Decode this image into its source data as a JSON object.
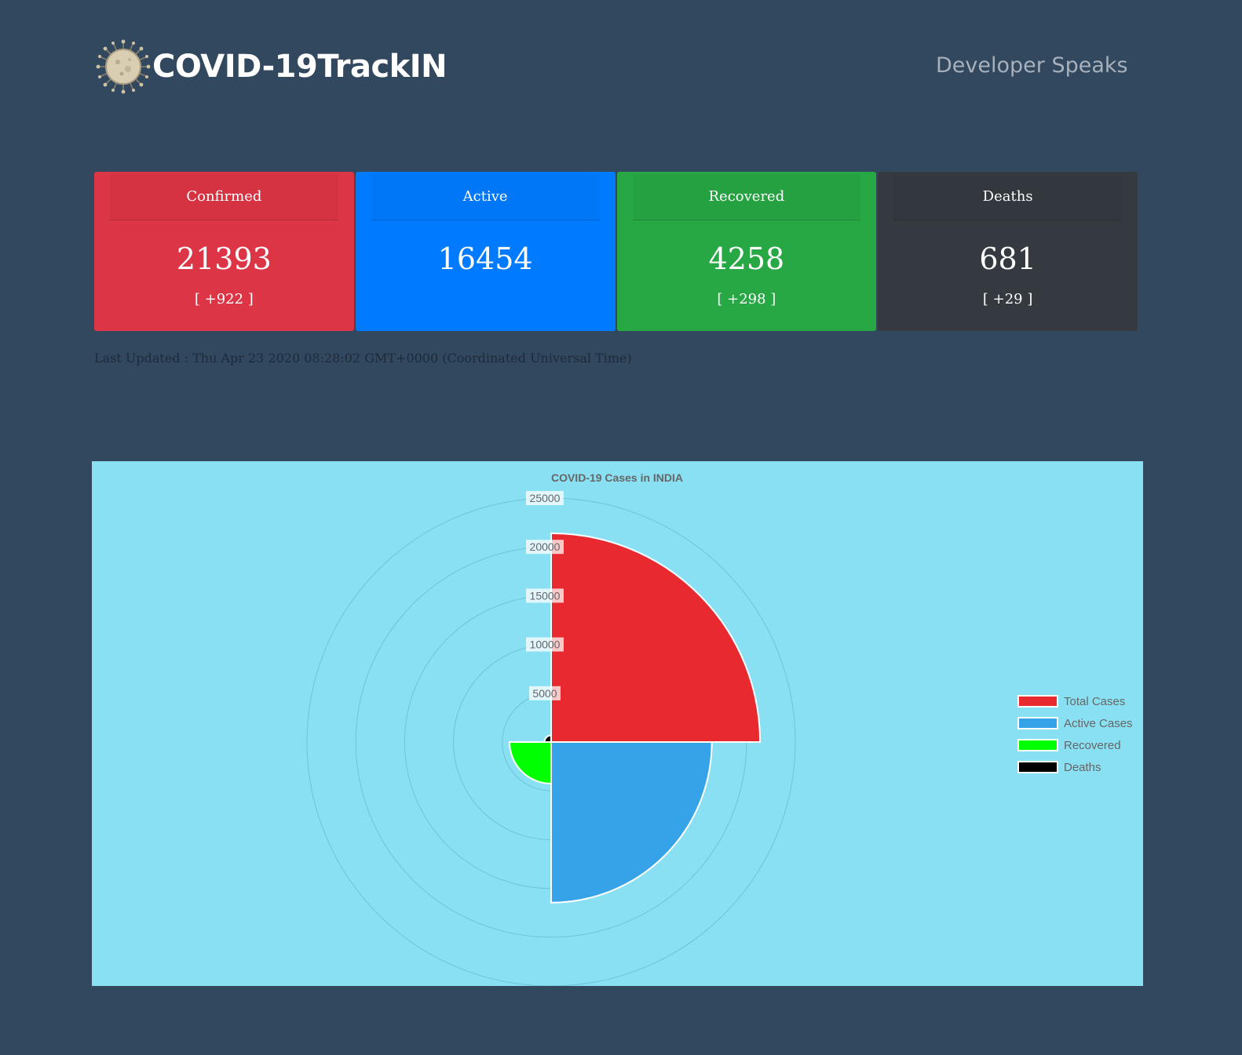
{
  "header": {
    "brand": "COVID-19TrackIN",
    "logo_icon": "virus-icon",
    "developer_link": "Developer Speaks"
  },
  "stats": [
    {
      "label": "Confirmed",
      "value": "21393",
      "delta": "[ +922 ]",
      "color": "#dc3545"
    },
    {
      "label": "Active",
      "value": "16454",
      "delta": "",
      "color": "#007bff"
    },
    {
      "label": "Recovered",
      "value": "4258",
      "delta": "[ +298 ]",
      "color": "#28a745"
    },
    {
      "label": "Deaths",
      "value": "681",
      "delta": "[ +29 ]",
      "color": "#343a40"
    }
  ],
  "last_updated": "Last Updated : Thu Apr 23 2020 08:28:02 GMT+0000 (Coordinated Universal Time)",
  "chart_data": {
    "type": "polarArea",
    "title": "COVID-19 Cases in INDIA",
    "categories": [
      "Total Cases",
      "Active Cases",
      "Recovered",
      "Deaths"
    ],
    "values": [
      21393,
      16454,
      4258,
      681
    ],
    "colors": [
      "#e8292f",
      "#36a2e8",
      "#00ff00",
      "#000000"
    ],
    "rlim": [
      0,
      25000
    ],
    "ticks": [
      5000,
      10000,
      15000,
      20000,
      25000
    ],
    "legend_position": "right",
    "background": "#89e0f3"
  }
}
